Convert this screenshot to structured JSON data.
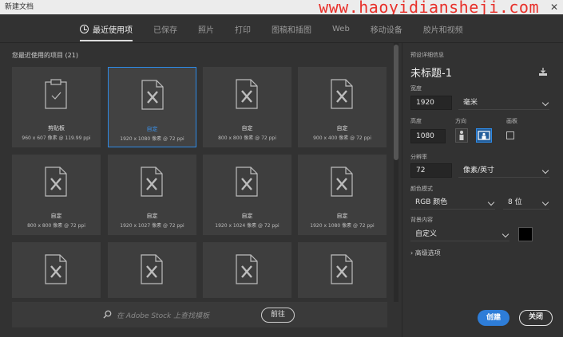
{
  "window": {
    "title": "新建文档",
    "watermark": "www.haoyidiansheji.com"
  },
  "tabs": [
    {
      "label": "最近使用项",
      "active": true
    },
    {
      "label": "已保存"
    },
    {
      "label": "照片"
    },
    {
      "label": "打印"
    },
    {
      "label": "图稿和插图"
    },
    {
      "label": "Web"
    },
    {
      "label": "移动设备"
    },
    {
      "label": "胶片和视频"
    }
  ],
  "recent": {
    "heading": "您最近使用的项目",
    "count": "(21)",
    "items": [
      {
        "name": "剪贴板",
        "dims": "960 x 607 像素 @ 119.99 ppi",
        "icon": "clipboard-icon"
      },
      {
        "name": "自定",
        "dims": "1920 x 1080 像素 @ 72 ppi",
        "icon": "document-icon",
        "selected": true
      },
      {
        "name": "自定",
        "dims": "800 x 800 像素 @ 72 ppi",
        "icon": "document-icon"
      },
      {
        "name": "自定",
        "dims": "900 x 400 像素 @ 72 ppi",
        "icon": "document-icon"
      },
      {
        "name": "自定",
        "dims": "800 x 800 像素 @ 72 ppi",
        "icon": "document-icon"
      },
      {
        "name": "自定",
        "dims": "1920 x 1027 像素 @ 72 ppi",
        "icon": "document-icon"
      },
      {
        "name": "自定",
        "dims": "1920 x 1024 像素 @ 72 ppi",
        "icon": "document-icon"
      },
      {
        "name": "自定",
        "dims": "1920 x 1080 像素 @ 72 ppi",
        "icon": "document-icon"
      },
      {
        "name": "",
        "dims": "",
        "icon": "document-icon"
      },
      {
        "name": "",
        "dims": "",
        "icon": "document-icon"
      },
      {
        "name": "",
        "dims": "",
        "icon": "document-icon"
      },
      {
        "name": "",
        "dims": "",
        "icon": "document-icon"
      }
    ]
  },
  "stock": {
    "placeholder": "在 Adobe Stock 上查找模板",
    "go_label": "前往"
  },
  "details": {
    "section_label": "预设详细信息",
    "preset_name": "未标题-1",
    "width_label": "宽度",
    "width_value": "1920",
    "width_unit": "毫米",
    "height_label": "高度",
    "height_value": "1080",
    "orientation_label": "方向",
    "artboard_label": "画板",
    "resolution_label": "分辨率",
    "resolution_value": "72",
    "resolution_unit": "像素/英寸",
    "color_mode_label": "颜色模式",
    "color_mode_value": "RGB 颜色",
    "bit_depth_value": "8 位",
    "background_label": "背景内容",
    "background_value": "自定义",
    "background_color": "#000000",
    "advanced_label": "高级选项"
  },
  "buttons": {
    "create": "创建",
    "close": "关闭"
  },
  "colors": {
    "accent": "#2e8ae6",
    "create_bg": "#2e7dd8"
  }
}
